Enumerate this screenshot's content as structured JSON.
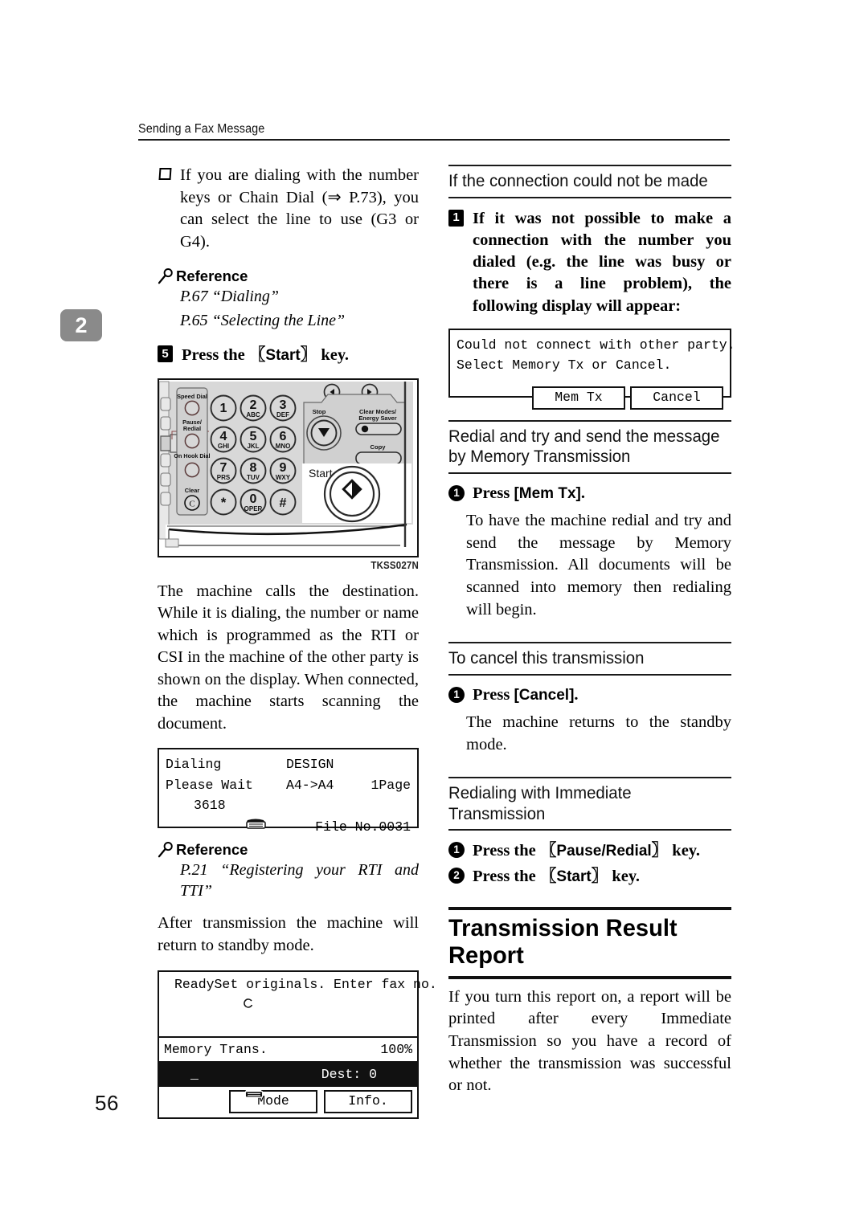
{
  "header": {
    "title": "Sending a Fax Message"
  },
  "chapter_tab": "2",
  "page_number": "56",
  "left_column": {
    "bullet": "If you are dialing with the number keys or Chain Dial (⇒ P.73), you can select the line to use (G3 or G4).",
    "reference_1": {
      "label": "Reference",
      "lines": [
        "P.67 “Dialing”",
        "P.65 “Selecting the Line”"
      ]
    },
    "step_5": {
      "number": "5",
      "text_before": "Press the ",
      "key": "Start",
      "text_after": " key."
    },
    "figure": {
      "caption": "TKSS027N",
      "labels": {
        "speed_dial": "Speed Dial",
        "pause_redial": "Pause/\nRedial",
        "on_hook_dial": "On Hook Dial",
        "clear": "Clear",
        "clear_letter": "C",
        "stop": "Stop",
        "clear_modes": "Clear Modes/\nEnergy Saver",
        "copy": "Copy",
        "start": "Start"
      },
      "keys": [
        {
          "digit": "1",
          "letters": ""
        },
        {
          "digit": "2",
          "letters": "ABC"
        },
        {
          "digit": "3",
          "letters": "DEF"
        },
        {
          "digit": "4",
          "letters": "GHI"
        },
        {
          "digit": "5",
          "letters": "JKL"
        },
        {
          "digit": "6",
          "letters": "MNO"
        },
        {
          "digit": "7",
          "letters": "PRS"
        },
        {
          "digit": "8",
          "letters": "TUV"
        },
        {
          "digit": "9",
          "letters": "WXY"
        },
        {
          "digit": "∗",
          "letters": ""
        },
        {
          "digit": "0",
          "letters": "OPER"
        },
        {
          "digit": "#",
          "letters": ""
        }
      ]
    },
    "paragraph_1": "The machine calls the destination. While it is dialing, the number or name which is programmed as the RTI or CSI in the machine of the other party is shown on the display. When connected, the machine starts scanning the document.",
    "lcd_dialing": {
      "line1_left": "Dialing",
      "line1_mid": "DESIGN",
      "line2_left": "Please Wait",
      "line2_mid": "A4->A4",
      "line2_right": "1Page",
      "line3_number": "3618",
      "line4_right": "File No.0031"
    },
    "reference_2": {
      "label": "Reference",
      "lines": [
        "P.21 “Registering your RTI and TTI”"
      ]
    },
    "paragraph_2": "After transmission the machine will return to standby mode.",
    "lcd_ready": {
      "line1_status": "Ready",
      "line1_msg": "Set originals. Enter fax no.",
      "line2_left": "Memory Trans.",
      "line2_right": "100%",
      "line3_cursor": "_",
      "line3_right": "Dest: 0",
      "btn_mode": "Mode",
      "btn_info": "Info."
    }
  },
  "right_column": {
    "section_1": {
      "title": "If the connection could not be made",
      "step": {
        "number": "1",
        "text": "If it was not possible to make a connection with the number you dialed (e.g. the line was busy or there is a line problem), the following display will appear:"
      },
      "lcd": {
        "line1": "Could not connect with other party.",
        "line2": "Select Memory Tx or Cancel.",
        "btn_mem_tx": "Mem Tx",
        "btn_cancel": "Cancel"
      }
    },
    "section_2": {
      "title": "Redial and try and send the message by Memory Transmission",
      "step": {
        "number": "1",
        "text_before": "Press ",
        "key": "[Mem Tx]",
        "text_after": "."
      },
      "body": "To have the machine redial and try and send the message by Memory Transmission. All documents will be scanned into memory then redialing will begin."
    },
    "section_3": {
      "title": "To cancel this transmission",
      "step": {
        "number": "1",
        "text_before": "Press ",
        "key": "[Cancel]",
        "text_after": "."
      },
      "body": "The machine returns to the standby mode."
    },
    "section_4": {
      "title": "Redialing with Immediate Transmission",
      "steps": [
        {
          "number": "1",
          "text_before": "Press the ",
          "key": "Pause/Redial",
          "text_after": " key."
        },
        {
          "number": "2",
          "text_before": "Press the ",
          "key": "Start",
          "text_after": " key."
        }
      ]
    },
    "section_5": {
      "title": "Transmission Result Report",
      "body": "If you turn this report on, a report will be printed after every Immediate Transmission so you have a record of whether the transmission was successful or not."
    }
  }
}
